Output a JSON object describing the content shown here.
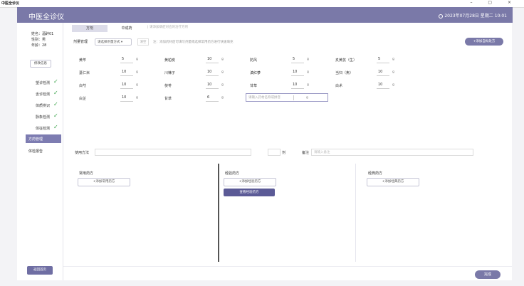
{
  "window": {
    "title": "中医全诊仪",
    "controls": "– ▢ ×"
  },
  "header": {
    "app_name": "中医全诊仪",
    "datetime": "2023年07月28日 星期二 10:01"
  },
  "patient": {
    "name": "姓名：酒醉01",
    "gender": "性别：男",
    "age": "年龄：28"
  },
  "sidebar": {
    "edit_button": "修改信息",
    "items": [
      {
        "label": "望诊检测",
        "done": "✓"
      },
      {
        "label": "舌诊检测",
        "done": "✓"
      },
      {
        "label": "体质辨识",
        "done": "✓"
      },
      {
        "label": "脉象检测",
        "done": "✓"
      },
      {
        "label": "体征检测",
        "done": "✓"
      },
      {
        "label": "方药管理",
        "done": ""
      },
      {
        "label": "体检报告",
        "done": ""
      }
    ],
    "bottom_button": "返回首页"
  },
  "tabs": [
    {
      "label": "方剂"
    },
    {
      "label": "中成药"
    }
  ],
  "tab_hint": "|  请添加病症对应的治疗方剂",
  "prescription": {
    "mode_label": "剂量管理",
    "mode_select": "请选择剂量方式 ▾",
    "clear_button": "清空",
    "hint": "注：添加药材后可填写剂量或选择常用药方进行快速填充",
    "add_button": "+添加自拟处方"
  },
  "herbs": [
    {
      "name": "黄芩",
      "dose": "5",
      "unit": "g"
    },
    {
      "name": "黄柏炭",
      "dose": "10",
      "unit": "g"
    },
    {
      "name": "防风",
      "dose": "5",
      "unit": "g"
    },
    {
      "name": "炙黄芪（生）",
      "dose": "5",
      "unit": "g"
    },
    {
      "name": "薏仁米",
      "dose": "10",
      "unit": "g"
    },
    {
      "name": "川楝子",
      "dose": "10",
      "unit": "g"
    },
    {
      "name": "滇红蔘",
      "dose": "10",
      "unit": "g"
    },
    {
      "name": "当归（焦）",
      "dose": "10",
      "unit": "g"
    },
    {
      "name": "白芍",
      "dose": "10",
      "unit": "g"
    },
    {
      "name": "茯苓",
      "dose": "10",
      "unit": "g"
    },
    {
      "name": "甘草",
      "dose": "10",
      "unit": "g"
    },
    {
      "name": "白术",
      "dose": "10",
      "unit": "g"
    },
    {
      "name": "白芷",
      "dose": "10",
      "unit": "g"
    },
    {
      "name": "甘草",
      "dose": "6",
      "unit": "g"
    }
  ],
  "custom_herb": {
    "placeholder": "请输入药材名称或拼音",
    "unit": "g"
  },
  "usage": {
    "label": "使用方法",
    "count_suffix": "剂",
    "note_label": "备注",
    "note_placeholder": "请输入备注"
  },
  "columns": [
    {
      "title": "常用药方",
      "button": "+添加常用药方",
      "primary": ""
    },
    {
      "title": "经验药方",
      "button": "+添加经验药方",
      "primary": "查看经验药方"
    },
    {
      "title": "经典药方",
      "button": "+添加经典药方",
      "primary": ""
    }
  ],
  "footer": {
    "done_button": "完成"
  },
  "colors": {
    "accent": "#7a79a8",
    "check": "#3aa34a"
  }
}
